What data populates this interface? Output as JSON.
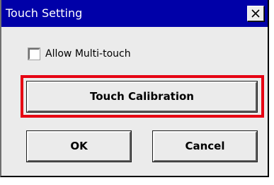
{
  "window": {
    "title": "Touch Setting",
    "close_icon": "close-icon"
  },
  "options": {
    "multitouch_label": "Allow Multi-touch",
    "multitouch_checked": false
  },
  "buttons": {
    "calibration_label": "Touch Calibration",
    "ok_label": "OK",
    "cancel_label": "Cancel"
  },
  "colors": {
    "titlebar": "#0000a8",
    "highlight": "#e60012",
    "dialog_bg": "#ebebeb"
  }
}
